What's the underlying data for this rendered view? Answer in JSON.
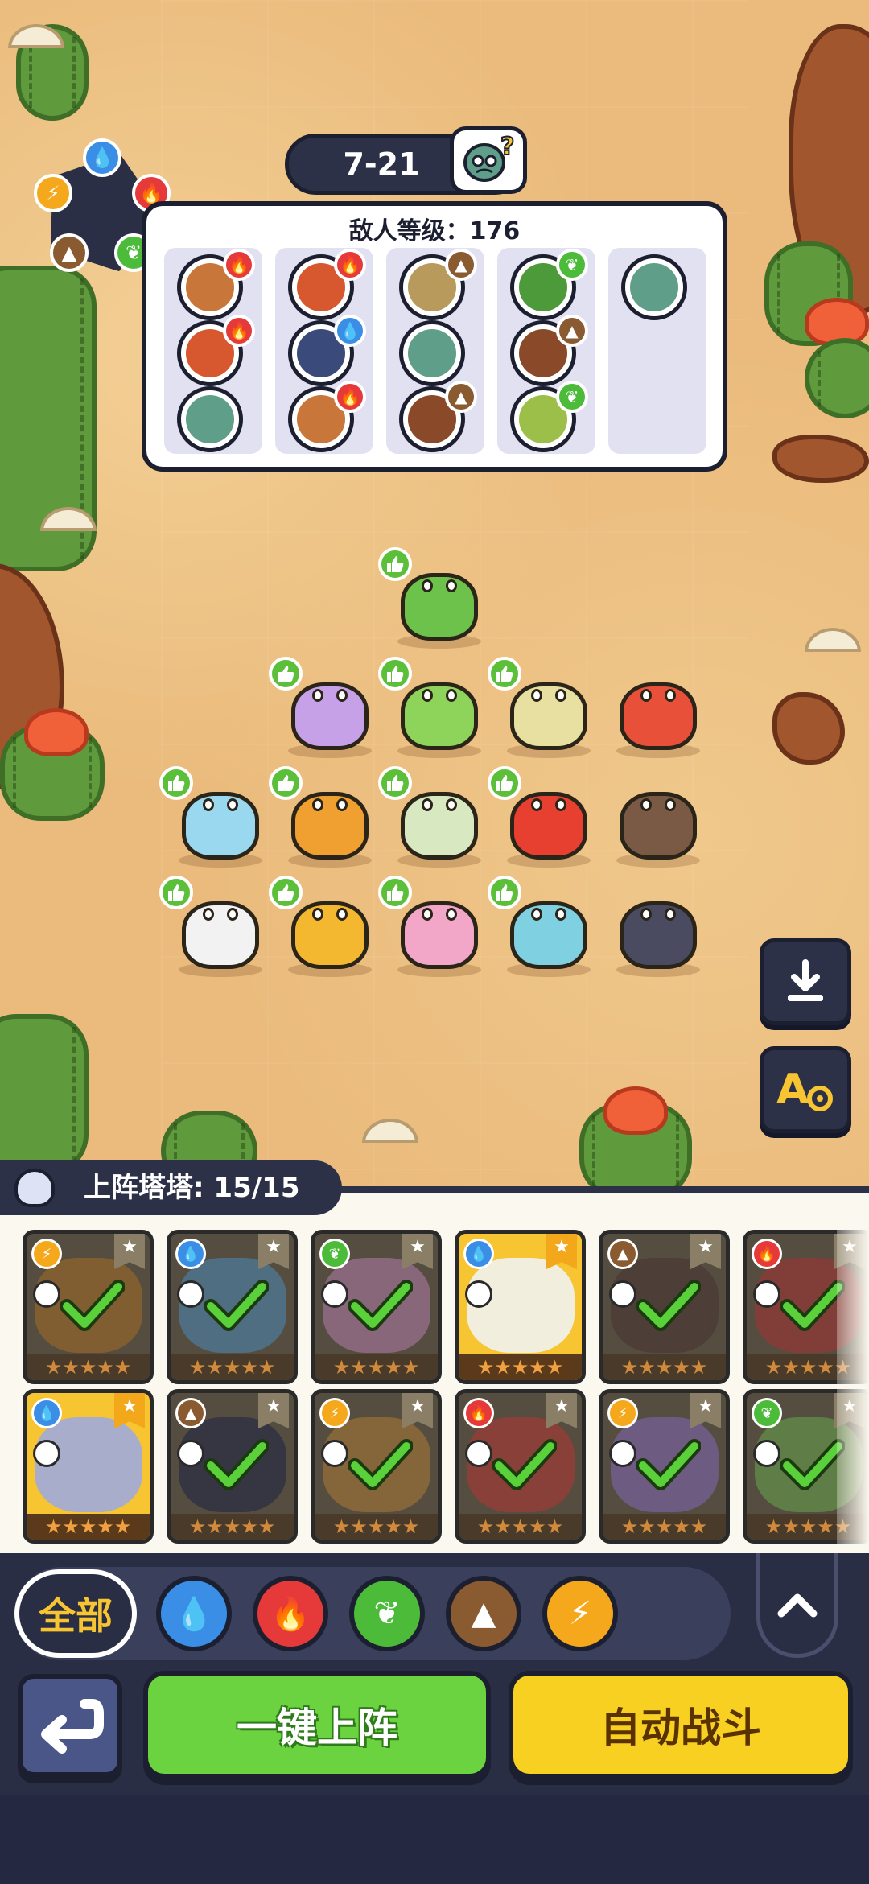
{
  "stage": {
    "label": "7-21",
    "boss_icon": "zombie-mystery-icon"
  },
  "enemy_panel": {
    "title": "敌人等级：176",
    "columns": [
      {
        "slots": [
          {
            "face": "#c9763a",
            "element": "fire"
          },
          {
            "face": "#d7582f",
            "element": "fire"
          },
          {
            "face": "#5f9f8a",
            "element": "none"
          }
        ]
      },
      {
        "slots": [
          {
            "face": "#d7582f",
            "element": "fire"
          },
          {
            "face": "#3a4a7a",
            "element": "water"
          },
          {
            "face": "#c9763a",
            "element": "fire"
          }
        ]
      },
      {
        "slots": [
          {
            "face": "#b89a5c",
            "element": "earth"
          },
          {
            "face": "#5f9f8a",
            "element": "none"
          },
          {
            "face": "#8a4a2a",
            "element": "earth"
          }
        ]
      },
      {
        "slots": [
          {
            "face": "#4c9a3a",
            "element": "leaf"
          },
          {
            "face": "#8a4a2a",
            "element": "earth"
          },
          {
            "face": "#9cbf4a",
            "element": "leaf"
          }
        ]
      },
      {
        "slots": [
          {
            "face": "#5f9f8a",
            "element": "none"
          }
        ]
      }
    ]
  },
  "element_colors": {
    "water": "#3a8ee6",
    "fire": "#e63a3a",
    "leaf": "#4cbb3a",
    "earth": "#8a5a30",
    "thunder": "#f5a81c",
    "none": "#5f9f8a"
  },
  "element_glyphs": {
    "water": "💧",
    "fire": "🔥",
    "leaf": "❦",
    "earth": "▲",
    "thunder": "⚡",
    "none": ""
  },
  "element_wheel": [
    "water",
    "fire",
    "leaf",
    "earth",
    "thunder"
  ],
  "board_units": [
    {
      "name": "cactus-flower-pet",
      "color": "#6cc24a",
      "col": 0,
      "row": 0
    },
    {
      "name": "purple-dragon-pet",
      "color": "#c7a1e8",
      "col": -1,
      "row": 1
    },
    {
      "name": "leaf-cat-pet",
      "color": "#8fd45a",
      "col": 0,
      "row": 1
    },
    {
      "name": "sprout-bird-pet",
      "color": "#e8e0a0",
      "col": 1,
      "row": 1
    },
    {
      "name": "red-fox-pet",
      "color": "#e8503a",
      "col": 2,
      "row": 1,
      "no_badge": true
    },
    {
      "name": "ice-seal-pet",
      "color": "#9ad8f0",
      "col": -2,
      "row": 2
    },
    {
      "name": "fire-goat-pet",
      "color": "#f0a030",
      "col": -1,
      "row": 2
    },
    {
      "name": "onion-nest-pet",
      "color": "#d8e8c0",
      "col": 0,
      "row": 2
    },
    {
      "name": "red-bird-pet",
      "color": "#e84030",
      "col": 1,
      "row": 2
    },
    {
      "name": "brown-monkey-pet",
      "color": "#7a5a44",
      "col": 2,
      "row": 2,
      "no_badge": true
    },
    {
      "name": "polar-bear-pet",
      "color": "#f2f2f2",
      "col": -2,
      "row": 3
    },
    {
      "name": "lion-pet",
      "color": "#f3b830",
      "col": -1,
      "row": 3
    },
    {
      "name": "pink-plant-pet",
      "color": "#f2a6c8",
      "col": 0,
      "row": 3
    },
    {
      "name": "turtle-pet",
      "color": "#7fd0e0",
      "col": 1,
      "row": 3
    },
    {
      "name": "dark-dino-pet",
      "color": "#4a4a60",
      "col": 2,
      "row": 3,
      "no_badge": true
    }
  ],
  "roster": {
    "header": "上阵塔塔: 15/15",
    "cards": [
      {
        "element": "thunder",
        "art": "#d6902c",
        "checked": true,
        "active": false,
        "stars": "★★★★★"
      },
      {
        "element": "water",
        "art": "#6fb3d8",
        "checked": true,
        "active": false,
        "stars": "★★★★★"
      },
      {
        "element": "leaf",
        "art": "#e8a3c8",
        "checked": true,
        "active": false,
        "stars": "★★★★★"
      },
      {
        "element": "water",
        "art": "#f0f4fb",
        "checked": false,
        "active": true,
        "stars": "★★★★★"
      },
      {
        "element": "earth",
        "art": "#6a4e3a",
        "checked": true,
        "active": false,
        "stars": "★★★★★"
      },
      {
        "element": "fire",
        "art": "#d84a3a",
        "checked": true,
        "active": false,
        "stars": "★★★★★"
      },
      {
        "element": "water",
        "art": "#9aa8e8",
        "checked": false,
        "active": true,
        "stars": "★★★★★"
      },
      {
        "element": "earth",
        "art": "#3a3a50",
        "checked": true,
        "active": false,
        "stars": "★★★★★"
      },
      {
        "element": "thunder",
        "art": "#e0a040",
        "checked": true,
        "active": false,
        "stars": "★★★★★"
      },
      {
        "element": "fire",
        "art": "#e8503a",
        "checked": true,
        "active": false,
        "stars": "★★★★★"
      },
      {
        "element": "thunder",
        "art": "#b08ad8",
        "checked": true,
        "active": false,
        "stars": "★★★★★"
      },
      {
        "element": "leaf",
        "art": "#8fd45a",
        "checked": true,
        "active": false,
        "stars": "★★★★★"
      }
    ]
  },
  "filters": {
    "all_label": "全部",
    "elements": [
      "water",
      "fire",
      "leaf",
      "earth",
      "thunder"
    ]
  },
  "actions": {
    "deploy_label": "一键上阵",
    "auto_battle_label": "自动战斗"
  }
}
